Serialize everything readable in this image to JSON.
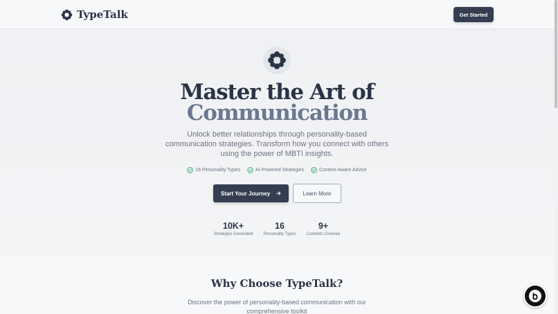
{
  "header": {
    "brand": "TypeTalk",
    "cta_label": "Get Started"
  },
  "hero": {
    "title_line1": "Master the Art of",
    "title_line2": "Communication",
    "subtitle": "Unlock better relationships through personality-based communication strategies. Transform how you connect with others using the power of MBTI insights.",
    "features": [
      {
        "label": "16 Personality Types"
      },
      {
        "label": "AI-Powered Strategies"
      },
      {
        "label": "Context-Aware Advice"
      }
    ],
    "primary_button": "Start Your Journey",
    "secondary_button": "Learn More",
    "stats": [
      {
        "value": "10K+",
        "label": "Strategies Generated"
      },
      {
        "value": "16",
        "label": "Personality Types"
      },
      {
        "value": "9+",
        "label": "Contexts Covered"
      }
    ]
  },
  "why": {
    "title": "Why Choose TypeTalk?",
    "subtitle": "Discover the power of personality-based communication with our comprehensive toolkit"
  },
  "colors": {
    "primary": "#343e50",
    "accent_text": "#6a7890",
    "check_green": "#22a35a"
  },
  "icons": {
    "logo": "flower-logo-icon",
    "feature_check": "check-circle-icon",
    "button_arrow": "arrow-right-icon",
    "badge": "built-with-badge-icon"
  }
}
